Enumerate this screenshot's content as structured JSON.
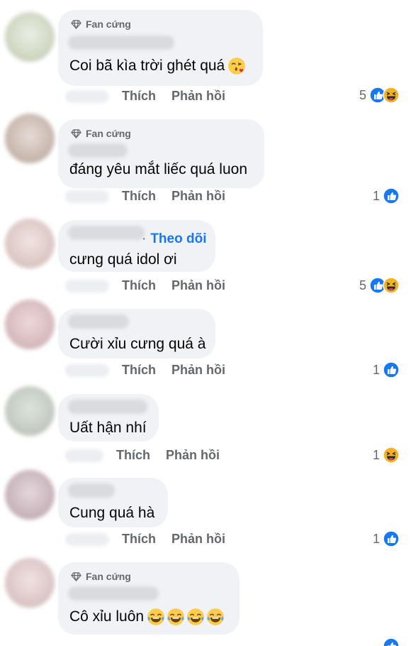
{
  "badge_label": "Fan cứng",
  "actions": {
    "like": "Thích",
    "reply": "Phản hồi"
  },
  "follow_label": "Theo dõi",
  "colors": {
    "bubble": "#f0f2f5",
    "like_blue": "#1877f2",
    "haha_yellow": "#f7b125",
    "meta_text": "#65676b"
  },
  "comments": [
    {
      "text": "Coi bã kìa trời ghét quá",
      "emoji": "kissing-heart",
      "reaction_count": "5",
      "reactions": [
        "like",
        "haha"
      ],
      "badge": true
    },
    {
      "text": "đáng yêu mắt liếc quá luon",
      "reaction_count": "1",
      "reactions": [
        "like"
      ],
      "badge": true
    },
    {
      "text": "cưng quá idol ơi",
      "reaction_count": "5",
      "reactions": [
        "like",
        "haha"
      ],
      "follow": true
    },
    {
      "text": "Cười xỉu cưng quá à",
      "reaction_count": "1",
      "reactions": [
        "like"
      ]
    },
    {
      "text": "Uất hận nhí",
      "reaction_count": "1",
      "reactions": [
        "haha"
      ]
    },
    {
      "text": "Cung quá hà",
      "reaction_count": "1",
      "reactions": [
        "like"
      ]
    },
    {
      "text": "Cô xỉu luôn",
      "emoji": "joy x4",
      "badge": true
    }
  ]
}
